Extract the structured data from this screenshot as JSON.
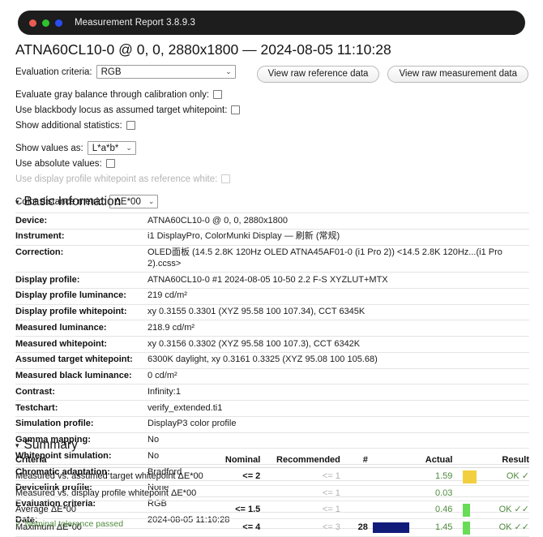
{
  "window": {
    "title": "Measurement Report 3.8.9.3",
    "traffic_lights": [
      "red",
      "green",
      "blue"
    ]
  },
  "page_title": "ATNA60CL10-0 @ 0, 0, 2880x1800 — 2024-08-05 11:10:28",
  "options": {
    "evaluation_criteria": {
      "label": "Evaluation criteria:",
      "value": "RGB",
      "chevron": "⌄"
    },
    "gray_balance": {
      "label": "Evaluate gray balance through calibration only:",
      "checked": false
    },
    "blackbody_locus": {
      "label": "Use blackbody locus as assumed target whitepoint:",
      "checked": false
    },
    "additional_statistics": {
      "label": "Show additional statistics:",
      "checked": false
    },
    "show_values_as": {
      "label": "Show values as:",
      "value": "L*a*b*",
      "chevron": "⌄"
    },
    "absolute_values": {
      "label": "Use absolute values:",
      "checked": false
    },
    "display_profile_whitepoint_ref": {
      "label": "Use display profile whitepoint as reference white:",
      "checked": false,
      "disabled": true
    },
    "color_distance_metric": {
      "label": "Color distance metric:",
      "value": "ΔE*00",
      "chevron": "⌄"
    }
  },
  "top_buttons": {
    "view_raw_reference": "View raw reference data",
    "view_raw_measurement": "View raw measurement data"
  },
  "sections": {
    "basic_information": "Basic Information",
    "summary": "Summary",
    "triangle": "▾"
  },
  "basic_information": [
    {
      "key": "Device:",
      "value": "ATNA60CL10-0 @ 0, 0, 2880x1800"
    },
    {
      "key": "Instrument:",
      "value": "i1 DisplayPro, ColorMunki Display — 刷新 (常规)"
    },
    {
      "key": "Correction:",
      "value": "OLED面板 (14.5 2.8K 120Hz OLED ATNA45AF01-0 (i1 Pro 2)) <14.5 2.8K 120Hz...(i1 Pro 2).ccss>"
    },
    {
      "key": "Display profile:",
      "value": "ATNA60CL10-0 #1 2024-08-05 10-50 2.2 F-S XYZLUT+MTX"
    },
    {
      "key": "Display profile luminance:",
      "value": "219 cd/m²"
    },
    {
      "key": "Display profile whitepoint:",
      "value": "xy 0.3155 0.3301 (XYZ 95.58 100 107.34), CCT 6345K"
    },
    {
      "key": "Measured luminance:",
      "value": "218.9 cd/m²"
    },
    {
      "key": "Measured whitepoint:",
      "value": "xy 0.3156 0.3302 (XYZ 95.58 100 107.3), CCT 6342K"
    },
    {
      "key": "Assumed target whitepoint:",
      "value": "6300K daylight, xy 0.3161 0.3325 (XYZ 95.08 100 105.68)"
    },
    {
      "key": "Measured black luminance:",
      "value": "0 cd/m²"
    },
    {
      "key": "Contrast:",
      "value": "Infinity:1"
    },
    {
      "key": "Testchart:",
      "value": "verify_extended.ti1"
    },
    {
      "key": "Simulation profile:",
      "value": "DisplayP3 color profile"
    },
    {
      "key": "Gamma mapping:",
      "value": "No"
    },
    {
      "key": "Whitepoint simulation:",
      "value": "No"
    },
    {
      "key": "Chromatic adaptation:",
      "value": "Bradford"
    },
    {
      "key": "Devicelink profile:",
      "value": "None"
    },
    {
      "key": "Evaluation criteria:",
      "value": "RGB"
    },
    {
      "key": "Date:",
      "value": "2024-08-05 11:10:28"
    }
  ],
  "summary": {
    "headers": {
      "criteria": "Criteria",
      "nominal": "Nominal",
      "recommended": "Recommended",
      "count": "#",
      "actual": "Actual",
      "result": "Result"
    },
    "rows": [
      {
        "criteria": "Measured vs. assumed target whitepoint ΔE*00",
        "nominal": "<= 2",
        "recommended": "<= 1",
        "count": "",
        "actual": "1.59",
        "result": "OK ✓",
        "swatch_count": "",
        "swatch_actual": "#f2cf3e"
      },
      {
        "criteria": "Measured vs. display profile whitepoint ΔE*00",
        "nominal": "",
        "recommended": "<= 1",
        "count": "",
        "actual": "0.03",
        "result": "",
        "swatch_count": "",
        "swatch_actual": ""
      },
      {
        "criteria": "Average ΔE*00",
        "nominal": "<= 1.5",
        "recommended": "<= 1",
        "count": "",
        "actual": "0.46",
        "result": "OK ✓✓",
        "swatch_count": "",
        "swatch_actual": "#66dd55"
      },
      {
        "criteria": "Maximum ΔE*00",
        "nominal": "<= 4",
        "recommended": "<= 3",
        "count": "28",
        "actual": "1.45",
        "result": "OK ✓✓",
        "swatch_count": "#111c7a",
        "swatch_actual": "#66dd55"
      }
    ]
  },
  "footer_note": "✓ Nominal tolerance passed",
  "colors": {
    "pass_green": "#4f8a3d",
    "warn_gold": "#f2cf3e",
    "ok_green": "#66dd55",
    "sample_navy": "#111c7a",
    "titlebar_bg": "#1d1d1d"
  }
}
